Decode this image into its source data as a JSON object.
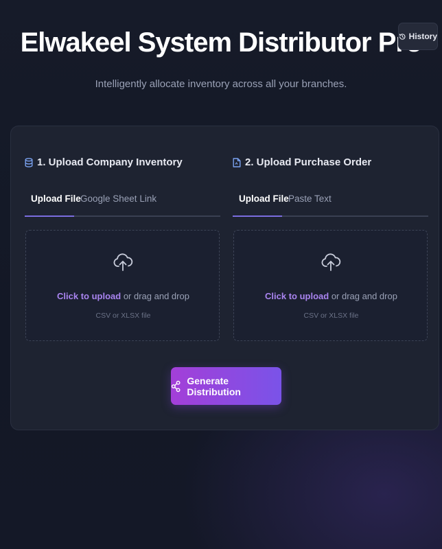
{
  "header": {
    "title": "Elwakeel System Distributor Pro",
    "subtitle": "Intelligently allocate inventory across all your branches.",
    "history_label": "History"
  },
  "sections": [
    {
      "heading": "1. Upload Company Inventory",
      "icon": "database-icon",
      "tabs": [
        {
          "label": "Upload File",
          "active": true
        },
        {
          "label": "Google Sheet Link",
          "active": false
        }
      ],
      "dropzone": {
        "link_text": "Click to upload",
        "rest_text": " or drag and drop",
        "hint": "CSV or XLSX file"
      }
    },
    {
      "heading": "2. Upload Purchase Order",
      "icon": "file-icon",
      "tabs": [
        {
          "label": "Upload File",
          "active": true
        },
        {
          "label": "Paste Text",
          "active": false
        }
      ],
      "dropzone": {
        "link_text": "Click to upload",
        "rest_text": " or drag and drop",
        "hint": "CSV or XLSX file"
      }
    }
  ],
  "generate_label": "Generate Distribution",
  "colors": {
    "accent": "#7b6de0",
    "link": "#a984f0",
    "button_gradient_start": "#a33fd8",
    "button_gradient_end": "#7a53e8",
    "card_bg": "#1e2331",
    "page_bg": "#161b29"
  }
}
